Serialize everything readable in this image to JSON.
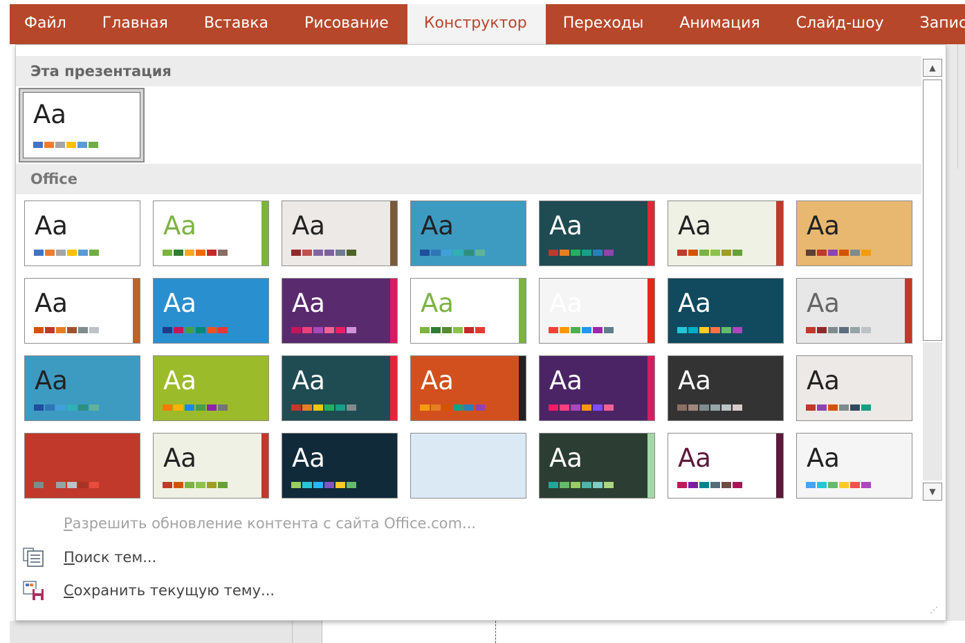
{
  "ribbon": {
    "tabs": [
      {
        "label": "Файл",
        "active": false
      },
      {
        "label": "Главная",
        "active": false
      },
      {
        "label": "Вставка",
        "active": false
      },
      {
        "label": "Рисование",
        "active": false
      },
      {
        "label": "Конструктор",
        "active": true
      },
      {
        "label": "Переходы",
        "active": false
      },
      {
        "label": "Анимация",
        "active": false
      },
      {
        "label": "Слайд-шоу",
        "active": false
      },
      {
        "label": "Запись",
        "active": false
      }
    ],
    "accent": "#b7472a"
  },
  "gallery": {
    "this_presentation": {
      "heading": "Эта презентация",
      "theme": {
        "glyph": "Aa",
        "swatches": [
          "#4472c4",
          "#ed7d31",
          "#a5a5a5",
          "#ffc000",
          "#5b9bd5",
          "#70ad47"
        ]
      }
    },
    "office": {
      "heading": "Office",
      "themes": [
        {
          "glyph": "Aa",
          "bg": "#ffffff",
          "fg": "#222222",
          "swatches": [
            "#4472c4",
            "#ed7d31",
            "#a5a5a5",
            "#ffc000",
            "#5b9bd5",
            "#70ad47"
          ]
        },
        {
          "glyph": "Aa",
          "bg": "#ffffff",
          "fg": "#7cb342",
          "accent": "#7cb342",
          "swatches": [
            "#7cb342",
            "#2e7d32",
            "#f9a825",
            "#ef6c00",
            "#c62828",
            "#8d6e63"
          ]
        },
        {
          "glyph": "Aa",
          "bg": "#ece9e6",
          "fg": "#222222",
          "accent": "#7a5a3a",
          "swatches": [
            "#8e2a2a",
            "#c0504d",
            "#8064a2",
            "#7d60a0",
            "#6d7b8d",
            "#4f6228"
          ]
        },
        {
          "glyph": "Aa",
          "bg": "#3d9bc2",
          "fg": "#222222",
          "swatches": [
            "#1f4e9b",
            "#2e75b6",
            "#41a0d9",
            "#31b0b6",
            "#2f8f7e",
            "#5fb39a"
          ]
        },
        {
          "glyph": "Aa",
          "bg": "#1f4b52",
          "fg": "#ffffff",
          "accent": "#e32636",
          "swatches": [
            "#c0392b",
            "#e67e22",
            "#27ae60",
            "#16a085",
            "#2980b9",
            "#8e44ad"
          ]
        },
        {
          "glyph": "Aa",
          "bg": "#eef1e3",
          "fg": "#222222",
          "accent": "#c0392b",
          "swatches": [
            "#c0392b",
            "#d35400",
            "#7cb342",
            "#8bc34a",
            "#9e9d24",
            "#689f38"
          ]
        },
        {
          "glyph": "Aa",
          "bg": "#e8b870",
          "fg": "#222222",
          "swatches": [
            "#5c4033",
            "#c0392b",
            "#8e44ad",
            "#d35400",
            "#7f8c8d",
            "#f39c12"
          ]
        },
        {
          "glyph": "Aa",
          "bg": "#ffffff",
          "fg": "#222222",
          "accent": "#c0612c",
          "swatches": [
            "#d35400",
            "#c0392b",
            "#e67e22",
            "#a0522d",
            "#7f8c8d",
            "#bdc3c7"
          ]
        },
        {
          "glyph": "Aa",
          "bg": "#2a8fcf",
          "fg": "#ffffff",
          "swatches": [
            "#1e3a8a",
            "#c2185b",
            "#43a047",
            "#00897b",
            "#f4511e",
            "#e53935"
          ]
        },
        {
          "glyph": "Aa",
          "bg": "#5a2a6e",
          "fg": "#ffffff",
          "accent": "#d81b60",
          "swatches": [
            "#c2185b",
            "#ec407a",
            "#ab47bc",
            "#f06292",
            "#e91e63",
            "#ce93d8"
          ]
        },
        {
          "glyph": "Aa",
          "bg": "#ffffff",
          "fg": "#7cb342",
          "accent": "#7cb342",
          "swatches": [
            "#7cb342",
            "#2e7d32",
            "#558b2f",
            "#8bc34a",
            "#c62828",
            "#e53935"
          ]
        },
        {
          "glyph": "Aa",
          "bg": "#f5f5f5",
          "fg": "#ffffff",
          "accent": "#e8261a",
          "swatches": [
            "#f44336",
            "#ff9800",
            "#4caf50",
            "#2196f3",
            "#9c27b0",
            "#607d8b"
          ]
        },
        {
          "glyph": "Aa",
          "bg": "#114a5e",
          "fg": "#ffffff",
          "swatches": [
            "#26c6da",
            "#00acc1",
            "#ffca28",
            "#ff7043",
            "#66bb6a",
            "#ab47bc"
          ]
        },
        {
          "glyph": "Aa",
          "bg": "#e7e7e7",
          "fg": "#666666",
          "accent": "#c0392b",
          "swatches": [
            "#c0392b",
            "#8e2a2a",
            "#7f8c8d",
            "#5d6d7e",
            "#95a5a6",
            "#bdc3c7"
          ]
        },
        {
          "glyph": "Aa",
          "bg": "#3d9bc2",
          "fg": "#222222",
          "swatches": [
            "#1f4e9b",
            "#2e75b6",
            "#41a0d9",
            "#31b0b6",
            "#2f8f7e",
            "#5fb39a"
          ]
        },
        {
          "glyph": "Aa",
          "bg": "#9cbb2a",
          "fg": "#ffffff",
          "swatches": [
            "#f57c00",
            "#ffb300",
            "#1e88e5",
            "#43a047",
            "#8e24aa",
            "#757575"
          ]
        },
        {
          "glyph": "Aa",
          "bg": "#1f4b52",
          "fg": "#ffffff",
          "accent": "#e32636",
          "swatches": [
            "#c0392b",
            "#e67e22",
            "#f1c40f",
            "#27ae60",
            "#16a085",
            "#7f8c8d"
          ]
        },
        {
          "glyph": "Aa",
          "bg": "#d2501e",
          "fg": "#ffffff",
          "accent": "#222222",
          "swatches": [
            "#f39c12",
            "#e67e22",
            "#d35400",
            "#16a085",
            "#2980b9",
            "#8e44ad"
          ]
        },
        {
          "glyph": "Aa",
          "bg": "#4b2466",
          "fg": "#ffffff",
          "accent": "#d81b60",
          "swatches": [
            "#e91e63",
            "#ff4081",
            "#ab47bc",
            "#ff9800",
            "#7c4dff",
            "#f06292"
          ]
        },
        {
          "glyph": "Aa",
          "bg": "#333333",
          "fg": "#ffffff",
          "swatches": [
            "#8d6e63",
            "#a1887f",
            "#7f8c8d",
            "#95a5a6",
            "#bdc3c7",
            "#d7ccc8"
          ]
        },
        {
          "glyph": "Aa",
          "bg": "#ece9e6",
          "fg": "#222222",
          "swatches": [
            "#c0392b",
            "#8e44ad",
            "#d35400",
            "#7f8c8d",
            "#34495e",
            "#16a085"
          ]
        },
        {
          "glyph": "Aa",
          "bg": "#c0392b",
          "fg": "#c0392b",
          "swatches": [
            "#7f8c8d",
            "#c0392b",
            "#95a5a6",
            "#bdc3c7",
            "#a93226",
            "#e74c3c"
          ]
        },
        {
          "glyph": "Aa",
          "bg": "#eef1e3",
          "fg": "#222222",
          "accent": "#c0392b",
          "swatches": [
            "#c0392b",
            "#d35400",
            "#7cb342",
            "#8bc34a",
            "#9e9d24",
            "#689f38"
          ]
        },
        {
          "glyph": "Aa",
          "bg": "#102a3a",
          "fg": "#ffffff",
          "swatches": [
            "#9ccc65",
            "#26c6da",
            "#29b6f6",
            "#7e57c2",
            "#ffca28",
            "#66bb6a"
          ]
        },
        {
          "glyph": "",
          "bg": "#dbe9f5",
          "fg": "#222222",
          "swatches": []
        },
        {
          "glyph": "Aa",
          "bg": "#2c3e33",
          "fg": "#ffffff",
          "accent": "#a5d6a7",
          "swatches": [
            "#26a69a",
            "#66bb6a",
            "#9ccc65",
            "#4db6ac",
            "#80cbc4",
            "#aed581"
          ]
        },
        {
          "glyph": "Aa",
          "bg": "#ffffff",
          "fg": "#5b1a3a",
          "accent": "#5b1a3a",
          "swatches": [
            "#c2185b",
            "#7b1fa2",
            "#00838f",
            "#546e7a",
            "#6d4c41",
            "#ad1457"
          ]
        },
        {
          "glyph": "Aa",
          "bg": "#f5f5f5",
          "fg": "#222222",
          "swatches": [
            "#42a5f5",
            "#26c6da",
            "#66bb6a",
            "#ffca28",
            "#ef5350",
            "#ab47bc"
          ]
        }
      ]
    }
  },
  "commands": {
    "allow_updates": "Разрешить обновление контента с сайта Office.com...",
    "browse_themes": "Поиск тем...",
    "save_theme": "Сохранить текущую тему..."
  },
  "icons": {
    "scroll_up": "▲",
    "scroll_down": "▼",
    "browse": "folder-icon",
    "save": "save-theme-icon"
  }
}
